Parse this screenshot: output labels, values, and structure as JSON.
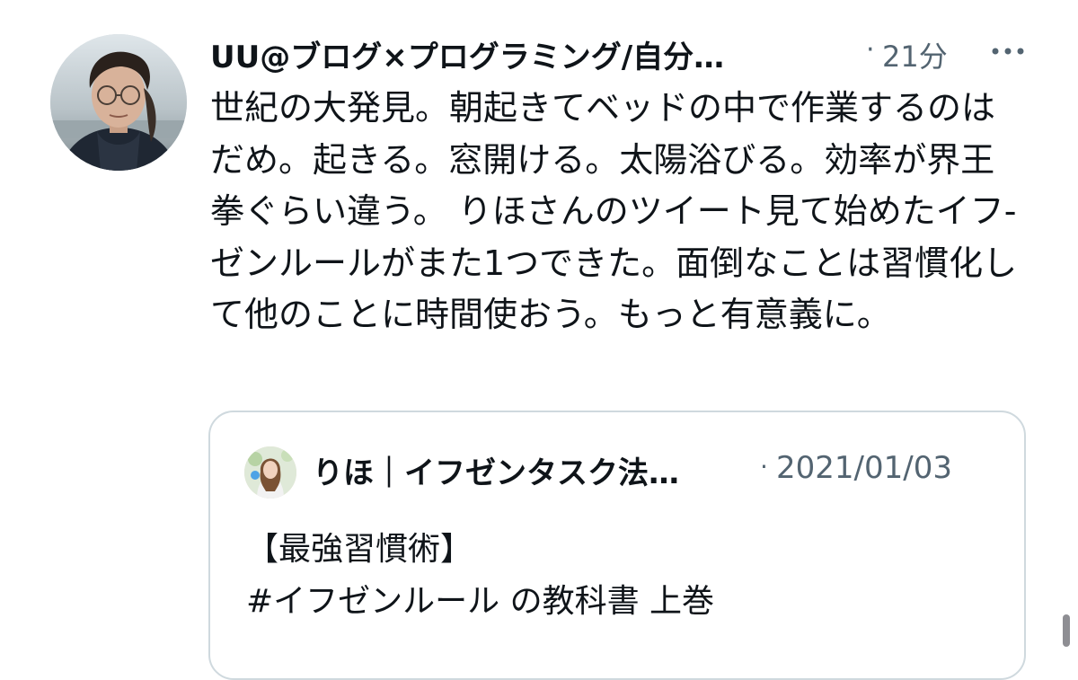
{
  "tweet": {
    "author_name": "UU@ブログ×プログラミング/自分…",
    "separator": "·",
    "time": "21分",
    "more_icon": "more-dots-icon",
    "avatar_icon": "user-avatar",
    "text": "世紀の大発見。朝起きてベッドの中で作業するのはだめ。起きる。窓開ける。太陽浴びる。効率が界王拳ぐらい違う。 りほさんのツイート見て始めたイフ-ゼンルールがまた1つできた。面倒なことは習慣化して他のことに時間使おう。もっと有意義に。"
  },
  "quote": {
    "avatar_icon": "quoted-user-avatar",
    "author_name": "りほ｜イフゼンタスク法…",
    "separator": "·",
    "date": "2021/01/03",
    "text_line1": "【最強習慣術】",
    "text_line2": "#イフゼンルール の教科書 上巻"
  },
  "colors": {
    "text": "#0f1419",
    "secondary": "#536471",
    "border": "#cfd9de"
  }
}
